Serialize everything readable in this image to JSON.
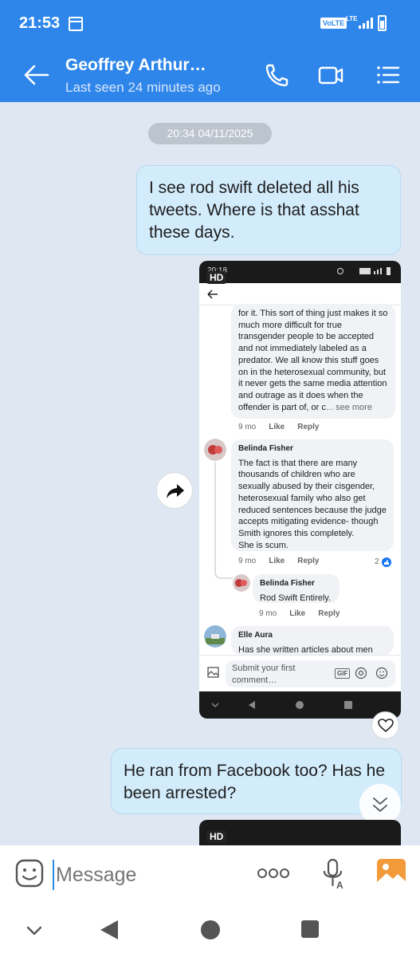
{
  "status_bar": {
    "time": "21:53",
    "volte": "VoLTE",
    "lte": "LTE"
  },
  "header": {
    "contact_name": "Geoffrey Arthur…",
    "last_seen": "Last seen 24 minutes ago"
  },
  "chat": {
    "date_chip": "20:34 04/11/2025",
    "messages": [
      {
        "text": "I see rod swift deleted all his tweets. Where is that asshat these days."
      },
      {
        "text": "He ran from Facebook too? Has he been arrested?"
      }
    ],
    "image_badge": "HD"
  },
  "embedded_screenshot": {
    "status_time": "20:18",
    "comment_1": {
      "text": "for it.  This sort of thing just makes it so much more difficult for true transgender people to be accepted and not immediately labeled as a predator.  We all know this stuff goes on in the heterosexual community, but it never gets the same media attention and outrage as it does when the offender is part of, or c",
      "see_more": "... see more",
      "age": "9 mo",
      "like": "Like",
      "reply": "Reply"
    },
    "comment_2": {
      "author": "Belinda Fisher",
      "text": "The fact is that there are many thousands of children who are sexually abused by their cisgender, heterosexual family who also get reduced sentences because the judge accepts mitigating evidence- though Smith ignores this completely.",
      "text_2": "She is scum.",
      "age": "9 mo",
      "like": "Like",
      "reply": "Reply",
      "reactions": "2"
    },
    "comment_3": {
      "author": "Belinda Fisher",
      "text": "Rod Swift Entirely.",
      "age": "9 mo",
      "like": "Like",
      "reply": "Reply"
    },
    "comment_4": {
      "author": "Elle Aura",
      "text": "Has she written articles about men"
    },
    "composer": {
      "placeholder": "Submit your first comment…",
      "gif": "GIF"
    }
  },
  "composer": {
    "placeholder": "Message"
  },
  "colors": {
    "header": "#2f86ea",
    "bubble": "#d3ecfc",
    "background": "#dfe8f2",
    "gallery_orange": "#f39a3a"
  }
}
